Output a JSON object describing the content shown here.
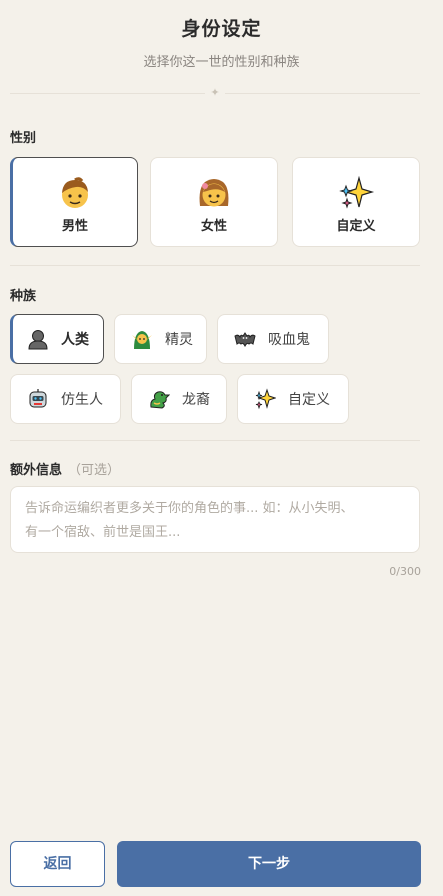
{
  "header": {
    "title": "身份设定",
    "subtitle": "选择你这一世的性别和种族",
    "divider_glyph": "✦"
  },
  "gender": {
    "label": "性别",
    "options": [
      {
        "label": "男性",
        "icon": "man-emoji-icon",
        "selected": true
      },
      {
        "label": "女性",
        "icon": "woman-emoji-icon",
        "selected": false
      },
      {
        "label": "自定义",
        "icon": "sparkles-icon",
        "selected": false
      }
    ]
  },
  "race": {
    "label": "种族",
    "options": [
      {
        "label": "人类",
        "icon": "human-silhouette-icon",
        "selected": true
      },
      {
        "label": "精灵",
        "icon": "elf-icon",
        "selected": false
      },
      {
        "label": "吸血鬼",
        "icon": "bat-icon",
        "selected": false
      },
      {
        "label": "仿生人",
        "icon": "robot-icon",
        "selected": false
      },
      {
        "label": "龙裔",
        "icon": "dragon-icon",
        "selected": false
      },
      {
        "label": "自定义",
        "icon": "sparkles-icon",
        "selected": false
      }
    ]
  },
  "extra": {
    "label": "额外信息",
    "optional_note": "（可选）",
    "placeholder_line1": "告诉命运编织者更多关于你的角色的事... 如：从小失明、",
    "placeholder_line2": "有一个宿敌、前世是国王...",
    "counter": "0/300"
  },
  "footer": {
    "back_label": "返回",
    "next_label": "下一步"
  },
  "colors": {
    "background": "#f4f1ea",
    "accent": "#4a6fa5",
    "card": "#ffffff",
    "border": "#e6e1d8"
  }
}
